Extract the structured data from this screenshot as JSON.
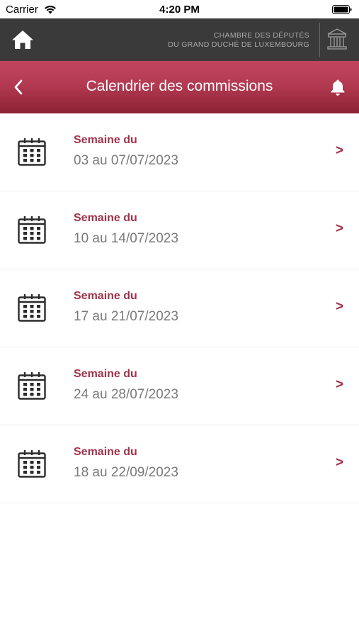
{
  "status_bar": {
    "carrier": "Carrier",
    "time": "4:20 PM"
  },
  "top_bar": {
    "institution_line1": "CHAMBRE DES DÉPUTÉS",
    "institution_line2": "DU GRAND DUCHÉ DE LUXEMBOURG"
  },
  "header": {
    "title": "Calendrier des commissions"
  },
  "weeks": [
    {
      "label": "Semaine du",
      "range": "03 au 07/07/2023",
      "chevron": ">"
    },
    {
      "label": "Semaine du",
      "range": "10 au 14/07/2023",
      "chevron": ">"
    },
    {
      "label": "Semaine du",
      "range": "17 au 21/07/2023",
      "chevron": ">"
    },
    {
      "label": "Semaine du",
      "range": "24 au 28/07/2023",
      "chevron": ">"
    },
    {
      "label": "Semaine du",
      "range": "18 au 22/09/2023",
      "chevron": ">"
    }
  ],
  "colors": {
    "accent": "#a0334a",
    "header_top": "#c2445e",
    "header_bottom": "#8c2233",
    "top_bar": "#3a3a3a",
    "date_text": "#7a7a7a"
  },
  "icons": {
    "home": "home-icon",
    "back": "chevron-left-icon",
    "bell": "bell-icon",
    "calendar": "calendar-icon",
    "building": "chamber-building-icon"
  }
}
